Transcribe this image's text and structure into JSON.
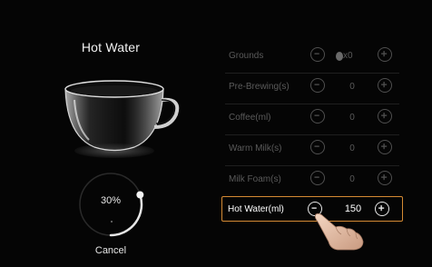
{
  "product": {
    "title": "Hot Water"
  },
  "progress": {
    "label": "30%",
    "fraction": 0.3
  },
  "cancel_label": "Cancel",
  "settings": [
    {
      "label": "Grounds",
      "value": "x0",
      "icon": "coffee-bean-icon"
    },
    {
      "label": "Pre-Brewing(s)",
      "value": "0"
    },
    {
      "label": "Coffee(ml)",
      "value": "0"
    },
    {
      "label": "Warm Milk(s)",
      "value": "0"
    },
    {
      "label": "Milk Foam(s)",
      "value": "0"
    },
    {
      "label": "Hot Water(ml)",
      "value": "150",
      "active": true
    }
  ],
  "colors": {
    "accent": "#d58a33",
    "dimmed": "#5a5a5a",
    "background": "#050505"
  }
}
